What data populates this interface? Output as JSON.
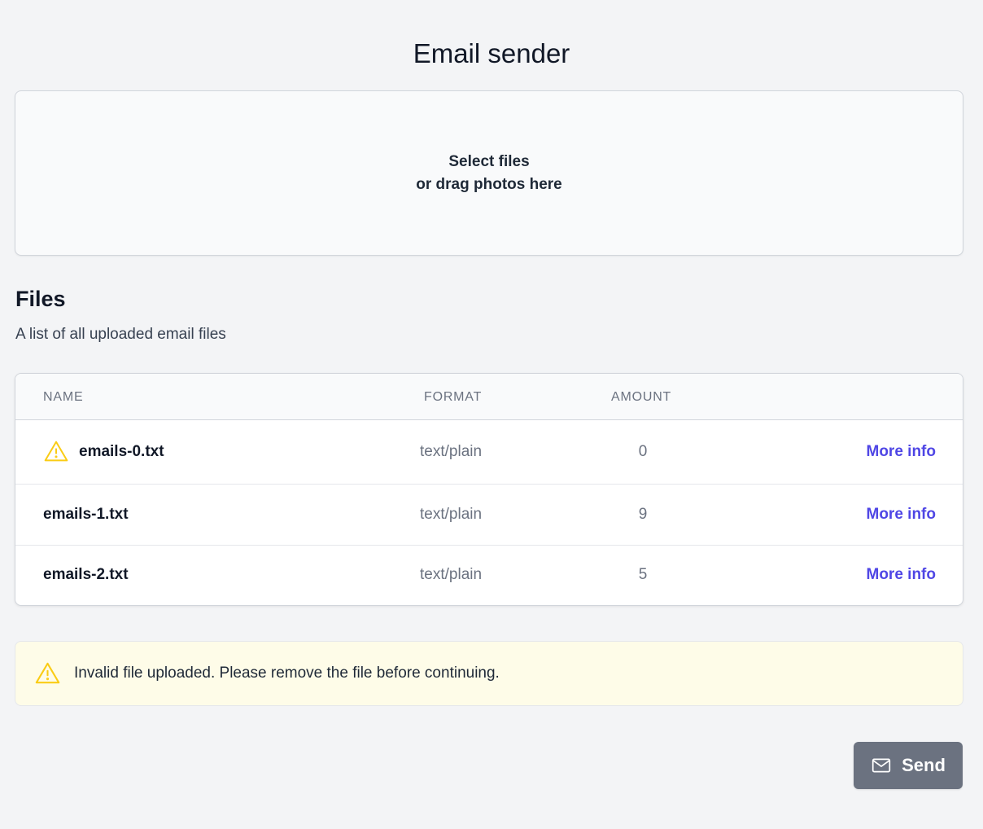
{
  "page": {
    "title": "Email sender"
  },
  "dropzone": {
    "line1": "Select files",
    "line2": "or drag photos here"
  },
  "files": {
    "heading": "Files",
    "subtitle": "A list of all uploaded email files",
    "columns": [
      "NAME",
      "FORMAT",
      "AMOUNT"
    ],
    "rows": [
      {
        "name": "emails-0.txt",
        "format": "text/plain",
        "amount": "0",
        "link": "More info",
        "warning": true
      },
      {
        "name": "emails-1.txt",
        "format": "text/plain",
        "amount": "9",
        "link": "More info",
        "warning": false
      },
      {
        "name": "emails-2.txt",
        "format": "text/plain",
        "amount": "5",
        "link": "More info",
        "warning": false
      }
    ]
  },
  "alert": {
    "icon": "warning-triangle-icon",
    "message": "Invalid file uploaded. Please remove the file before continuing."
  },
  "send_button": {
    "icon": "envelope-icon",
    "label": "Send"
  },
  "colors": {
    "background": "#f3f4f6",
    "link": "#4f46e5",
    "warning": "#facc15",
    "alert_bg": "#fefce8",
    "button_bg": "#6b7280"
  }
}
